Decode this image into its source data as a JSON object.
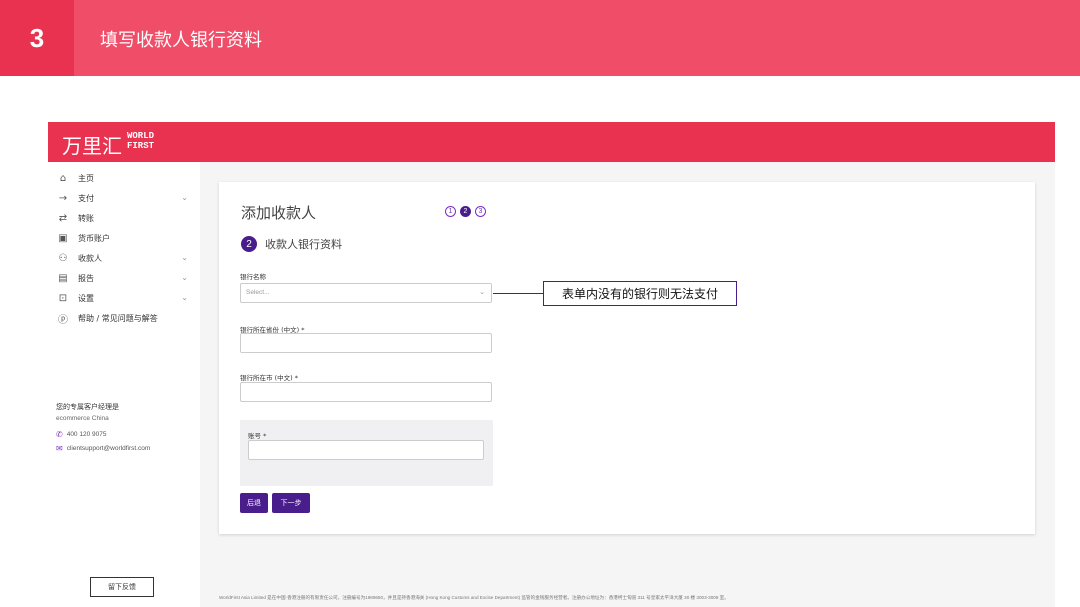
{
  "banner": {
    "step_number": "3",
    "title": "填写收款人银行资料",
    "colors": {
      "banner": "#ef4d68",
      "step_box": "#e8324f"
    }
  },
  "app": {
    "logo_cn": "万里汇",
    "logo_en_line1": "WORLD",
    "logo_en_line2": "FIRST",
    "header_color": "#e8324f",
    "accent_color": "#4a1d8c"
  },
  "sidebar": {
    "items": [
      {
        "icon": "home-icon",
        "label": "主页",
        "has_chevron": false
      },
      {
        "icon": "arrow-right-icon",
        "label": "支付",
        "has_chevron": true
      },
      {
        "icon": "transfer-icon",
        "label": "转账",
        "has_chevron": false
      },
      {
        "icon": "currency-account-icon",
        "label": "货币账户",
        "has_chevron": false
      },
      {
        "icon": "payees-icon",
        "label": "收款人",
        "has_chevron": true
      },
      {
        "icon": "report-icon",
        "label": "报告",
        "has_chevron": true
      },
      {
        "icon": "settings-icon",
        "label": "设置",
        "has_chevron": true
      },
      {
        "icon": "help-icon",
        "label": "帮助 / 常见问题与解答",
        "has_chevron": false
      }
    ],
    "manager": {
      "title": "您的专属客户经理是",
      "name": "ecommerce China",
      "phone": "400 120 9075",
      "email": "clientsupport@worldfirst.com"
    },
    "feedback_label": "留下反馈"
  },
  "form": {
    "title": "添加收款人",
    "steps": [
      "1",
      "2",
      "3"
    ],
    "active_step": 2,
    "section_number": "2",
    "section_title": "收款人银行资料",
    "bank_name_label": "银行名称",
    "bank_name_placeholder": "Select...",
    "province_label": "银行所在省份 (中文) *",
    "city_label": "银行所在市 (中文) *",
    "account_label": "账号 *",
    "back_label": "后退",
    "next_label": "下一步"
  },
  "footer": {
    "text": "WorldFirst Asia Limited 是在中国·香港注册的有限责任公司，注册编号为1989650，并且是持香港海关 (Hong Kong Customs and Excise Department) 监管的金钱服务经营者。注册办公地址为：香港柯士甸道 311 号皇家太平洋大厦 30 楼 3003-3008 室。"
  },
  "annotation": {
    "text": "表单内没有的银行则无法支付"
  }
}
